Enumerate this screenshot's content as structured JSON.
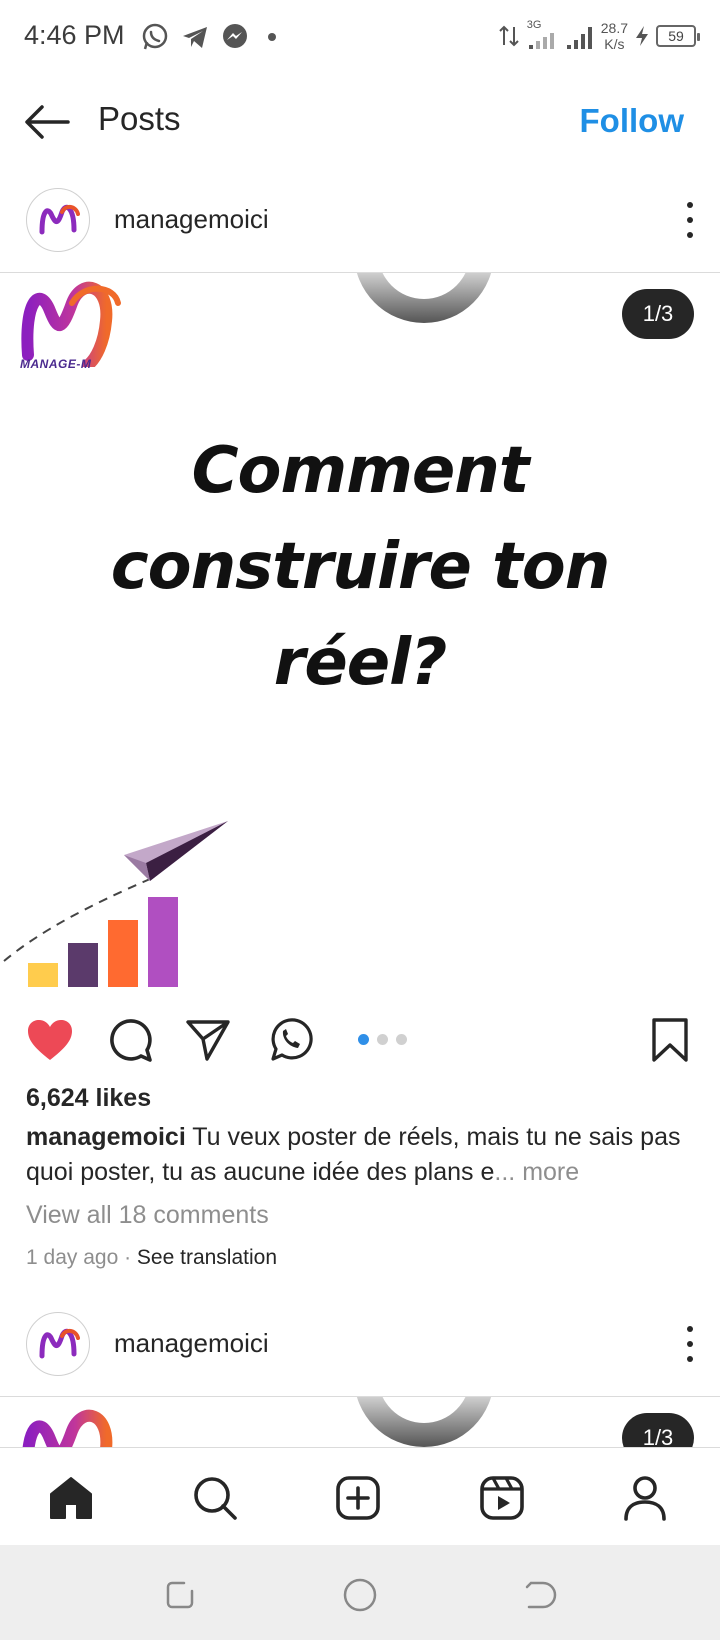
{
  "status_bar": {
    "time": "4:46 PM",
    "network": "3G",
    "speed_value": "28.7",
    "speed_unit": "K/s",
    "battery": "59"
  },
  "header": {
    "title": "Posts",
    "follow_label": "Follow"
  },
  "post": {
    "username": "managemoici",
    "logo_text": "MANAGE-M",
    "counter": "1/3",
    "headline_line1": "Comment",
    "headline_line2": "construire ton",
    "headline_line3": "réel?",
    "likes": "6,624 likes",
    "caption_user": "managemoici",
    "caption_text": " Tu veux poster de réels, mais tu ne sais pas quoi poster, tu as aucune idée des plans e",
    "caption_more": "... more",
    "view_comments": "View all 18 comments",
    "time_ago": "1 day ago",
    "meta_separator": " · ",
    "see_translation": "See translation",
    "carousel": {
      "total": 3,
      "active": 1
    },
    "liked": true
  },
  "next_post": {
    "username": "managemoici",
    "counter": "1/3"
  },
  "colors": {
    "accent": "#1f8fe5",
    "like_red": "#ed4956",
    "bar_yellow": "#ffcc4d",
    "bar_purple_dark": "#5b3a6b",
    "bar_orange": "#ff6a30",
    "bar_violet": "#b04fc1",
    "plane": "#c3a8c9"
  },
  "icons": {
    "back": "arrow-left-icon",
    "like": "heart-icon",
    "comment": "comment-icon",
    "share": "send-icon",
    "whatsapp": "whatsapp-icon",
    "save": "bookmark-icon",
    "home": "home-icon",
    "search": "search-icon",
    "create": "plus-square-icon",
    "reels": "reels-icon",
    "profile": "profile-icon"
  }
}
